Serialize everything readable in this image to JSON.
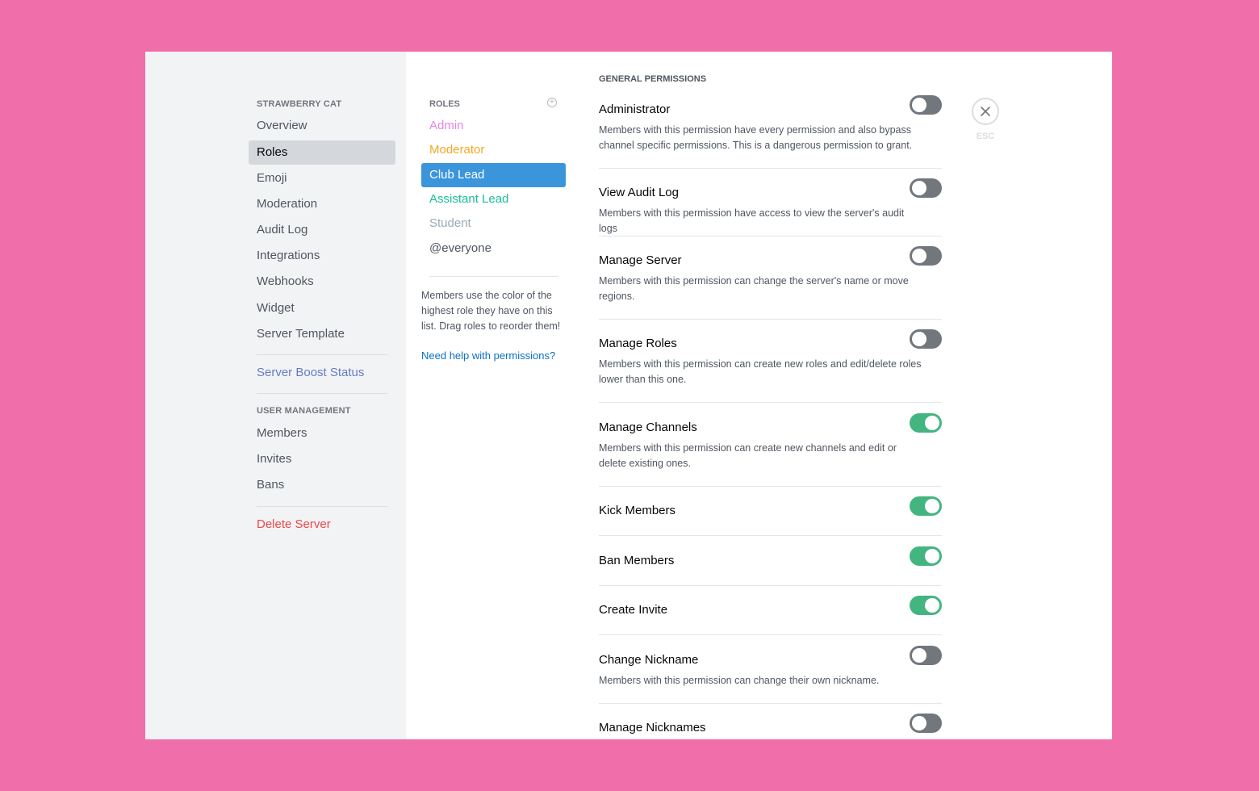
{
  "sidebar": {
    "server_header": "STRAWBERRY CAT",
    "items": [
      {
        "label": "Overview"
      },
      {
        "label": "Roles",
        "selected": true
      },
      {
        "label": "Emoji"
      },
      {
        "label": "Moderation"
      },
      {
        "label": "Audit Log"
      },
      {
        "label": "Integrations"
      },
      {
        "label": "Webhooks"
      },
      {
        "label": "Widget"
      },
      {
        "label": "Server Template"
      }
    ],
    "boost_label": "Server Boost Status",
    "user_mgmt_header": "USER MANAGEMENT",
    "user_items": [
      {
        "label": "Members"
      },
      {
        "label": "Invites"
      },
      {
        "label": "Bans"
      }
    ],
    "delete_label": "Delete Server"
  },
  "roles": {
    "header": "ROLES",
    "add_icon": "plus-circle-icon",
    "items": [
      {
        "label": "Admin",
        "color": "#e684e6"
      },
      {
        "label": "Moderator",
        "color": "#f5a623"
      },
      {
        "label": "Club Lead",
        "color": "#ffffff",
        "background": "#3b95db",
        "selected": true
      },
      {
        "label": "Assistant Lead",
        "color": "#1abc9c"
      },
      {
        "label": "Student",
        "color": "#99aab5"
      },
      {
        "label": "@everyone",
        "color": "#4f5660"
      }
    ],
    "hint": "Members use the color of the highest role they have on this list. Drag roles to reorder them!",
    "help_link": "Need help with permissions?"
  },
  "permissions": {
    "section_title": "GENERAL PERMISSIONS",
    "items": [
      {
        "name": "Administrator",
        "desc": "Members with this permission have every permission and also bypass channel specific permissions. This is a dangerous permission to grant.",
        "enabled": false
      },
      {
        "name": "View Audit Log",
        "desc": "Members with this permission have access to view the server's audit logs",
        "enabled": false
      },
      {
        "name": "Manage Server",
        "desc": "Members with this permission can change the server's name or move regions.",
        "enabled": false
      },
      {
        "name": "Manage Roles",
        "desc": "Members with this permission can create new roles and edit/delete roles lower than this one.",
        "enabled": false
      },
      {
        "name": "Manage Channels",
        "desc": "Members with this permission can create new channels and edit or delete existing ones.",
        "enabled": true
      },
      {
        "name": "Kick Members",
        "desc": "",
        "enabled": true
      },
      {
        "name": "Ban Members",
        "desc": "",
        "enabled": true
      },
      {
        "name": "Create Invite",
        "desc": "",
        "enabled": true
      },
      {
        "name": "Change Nickname",
        "desc": "Members with this permission can change their own nickname.",
        "enabled": false
      },
      {
        "name": "Manage Nicknames",
        "desc": "",
        "enabled": false
      }
    ]
  },
  "close": {
    "icon": "close-icon",
    "label": "ESC"
  },
  "colors": {
    "accent": "#3b95db",
    "toggle_on": "#43b581",
    "toggle_off": "#72767d",
    "danger": "#f04747",
    "boost": "#677bc4",
    "background": "#f06ea9"
  }
}
